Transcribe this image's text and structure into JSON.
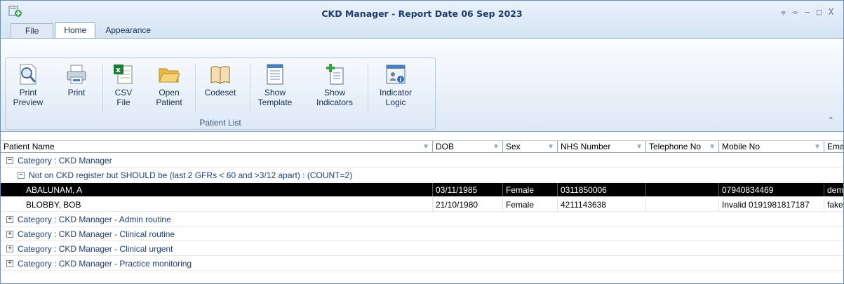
{
  "window": {
    "title": "CKD Manager - Report Date 06 Sep 2023",
    "controls": [
      "⩦",
      "⌯",
      "–",
      "□",
      "X"
    ]
  },
  "tabs": [
    {
      "label": "File"
    },
    {
      "label": "Home"
    },
    {
      "label": "Appearance"
    }
  ],
  "ribbon": {
    "group_label": "Patient List",
    "buttons": [
      {
        "label": "Print\nPreview",
        "icon": "print-preview-icon"
      },
      {
        "label": "Print",
        "icon": "printer-icon"
      },
      {
        "label": "CSV\nFile",
        "icon": "excel-csv-icon"
      },
      {
        "label": "Open\nPatient",
        "icon": "open-folder-icon"
      },
      {
        "label": "Codeset",
        "icon": "book-icon"
      },
      {
        "label": "Show\nTemplate",
        "icon": "template-icon"
      },
      {
        "label": "Show\nIndicators",
        "icon": "add-indicator-icon"
      },
      {
        "label": "Indicator\nLogic",
        "icon": "indicator-logic-icon"
      }
    ],
    "collapse_glyph": "⌃"
  },
  "grid": {
    "columns": [
      "Patient Name",
      "DOB",
      "Sex",
      "NHS Number",
      "Telephone No",
      "Mobile No",
      "Ema"
    ],
    "category_ckd": "Category : CKD Manager",
    "subgroup": "Not on CKD register but SHOULD be (last 2 GFRs < 60 and >3/12 apart) : (COUNT=2)",
    "rows": [
      {
        "name": "ABALUNAM, A",
        "dob": "03/11/1985",
        "sex": "Female",
        "nhs": "0311850006",
        "tel": "",
        "mobile": "07940834469",
        "email": "dem"
      },
      {
        "name": "BLOBBY, BOB",
        "dob": "21/10/1980",
        "sex": "Female",
        "nhs": "4211143638",
        "tel": "",
        "mobile": "Invalid 0191981817187",
        "email": "fake"
      }
    ],
    "collapsed_categories": [
      "Category : CKD Manager - Admin routine",
      "Category : CKD Manager - Clinical routine",
      "Category : CKD Manager - Clinical urgent",
      "Category : CKD Manager - Practice monitoring"
    ],
    "expand_glyph": "+",
    "collapse_row_glyph": "−"
  }
}
